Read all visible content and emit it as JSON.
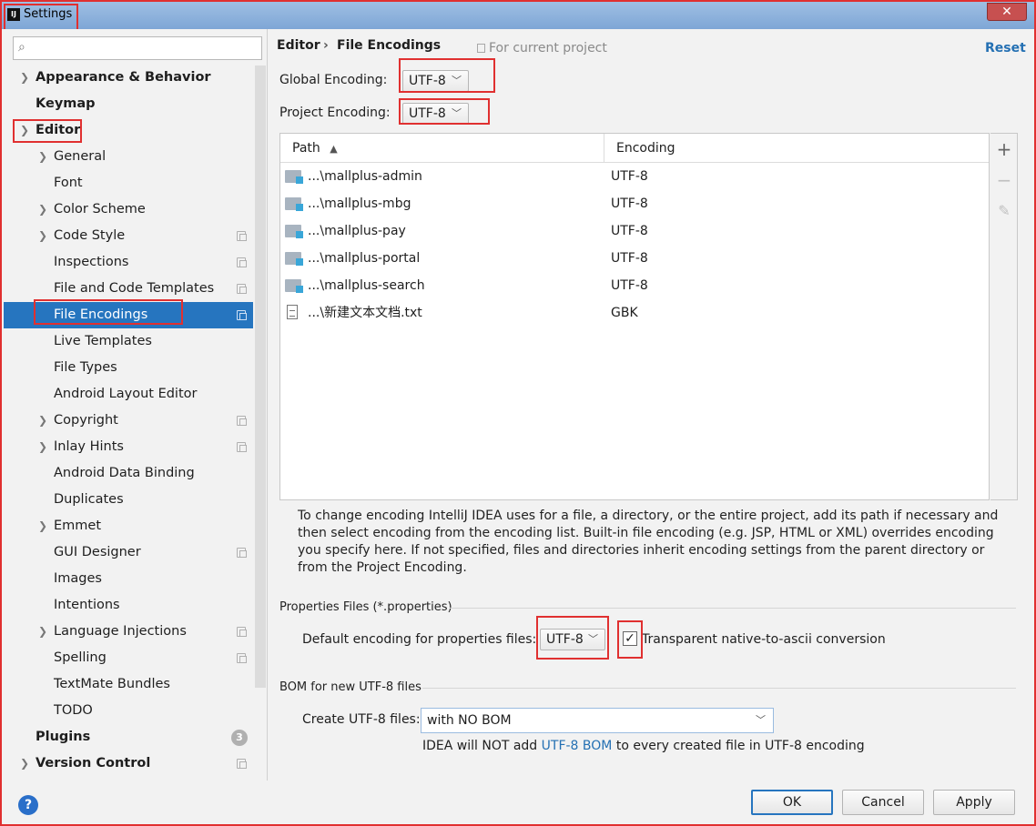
{
  "window": {
    "title": "Settings",
    "logo_text": "IJ",
    "close_glyph": "✕",
    "accent_color": "#2675bf",
    "highlight_color": "#e03030"
  },
  "sidebar": {
    "search_placeholder": "",
    "items": [
      {
        "label": "Appearance & Behavior"
      },
      {
        "label": "Keymap"
      },
      {
        "label": "Editor"
      },
      {
        "label": "General"
      },
      {
        "label": "Font"
      },
      {
        "label": "Color Scheme"
      },
      {
        "label": "Code Style"
      },
      {
        "label": "Inspections"
      },
      {
        "label": "File and Code Templates"
      },
      {
        "label": "File Encodings"
      },
      {
        "label": "Live Templates"
      },
      {
        "label": "File Types"
      },
      {
        "label": "Android Layout Editor"
      },
      {
        "label": "Copyright"
      },
      {
        "label": "Inlay Hints"
      },
      {
        "label": "Android Data Binding"
      },
      {
        "label": "Duplicates"
      },
      {
        "label": "Emmet"
      },
      {
        "label": "GUI Designer"
      },
      {
        "label": "Images"
      },
      {
        "label": "Intentions"
      },
      {
        "label": "Language Injections"
      },
      {
        "label": "Spelling"
      },
      {
        "label": "TextMate Bundles"
      },
      {
        "label": "TODO"
      },
      {
        "label": "Plugins",
        "badge": "3"
      },
      {
        "label": "Version Control"
      }
    ]
  },
  "header": {
    "breadcrumb_parent": "Editor",
    "breadcrumb_sep": "›",
    "breadcrumb_current": "File Encodings",
    "scope_label": "For current project",
    "reset_label": "Reset"
  },
  "encodings": {
    "global_label": "Global Encoding:",
    "global_value": "UTF-8",
    "project_label": "Project Encoding:",
    "project_value": "UTF-8"
  },
  "table": {
    "col_path": "Path",
    "col_encoding": "Encoding",
    "sort_glyph": "▲",
    "rows": [
      {
        "path": "...\\mallplus-admin",
        "encoding": "UTF-8"
      },
      {
        "path": "...\\mallplus-mbg",
        "encoding": "UTF-8"
      },
      {
        "path": "...\\mallplus-pay",
        "encoding": "UTF-8"
      },
      {
        "path": "...\\mallplus-portal",
        "encoding": "UTF-8"
      },
      {
        "path": "...\\mallplus-search",
        "encoding": "UTF-8"
      },
      {
        "path": "...\\新建文本文档.txt",
        "encoding": "GBK"
      }
    ],
    "tools": {
      "add": "+",
      "remove": "−",
      "edit": "✎"
    }
  },
  "help_text": "To change encoding IntelliJ IDEA uses for a file, a directory, or the entire project, add its path if necessary and then select encoding from the encoding list. Built-in file encoding (e.g. JSP, HTML or XML) overrides encoding you specify here. If not specified, files and directories inherit encoding settings from the parent directory or from the Project Encoding.",
  "properties": {
    "section_title": "Properties Files (*.properties)",
    "default_label": "Default encoding for properties files:",
    "default_value": "UTF-8",
    "checkbox_label": "Transparent native-to-ascii conversion",
    "checkbox_checked": true,
    "check_glyph": "✓"
  },
  "bom": {
    "section_title": "BOM for new UTF-8 files",
    "create_label": "Create UTF-8 files:",
    "create_value": "with NO BOM",
    "note_prefix": "IDEA will NOT add ",
    "note_link": "UTF-8 BOM",
    "note_suffix": " to every created file in UTF-8 encoding"
  },
  "footer": {
    "help_glyph": "?",
    "ok_label": "OK",
    "cancel_label": "Cancel",
    "apply_label": "Apply"
  }
}
